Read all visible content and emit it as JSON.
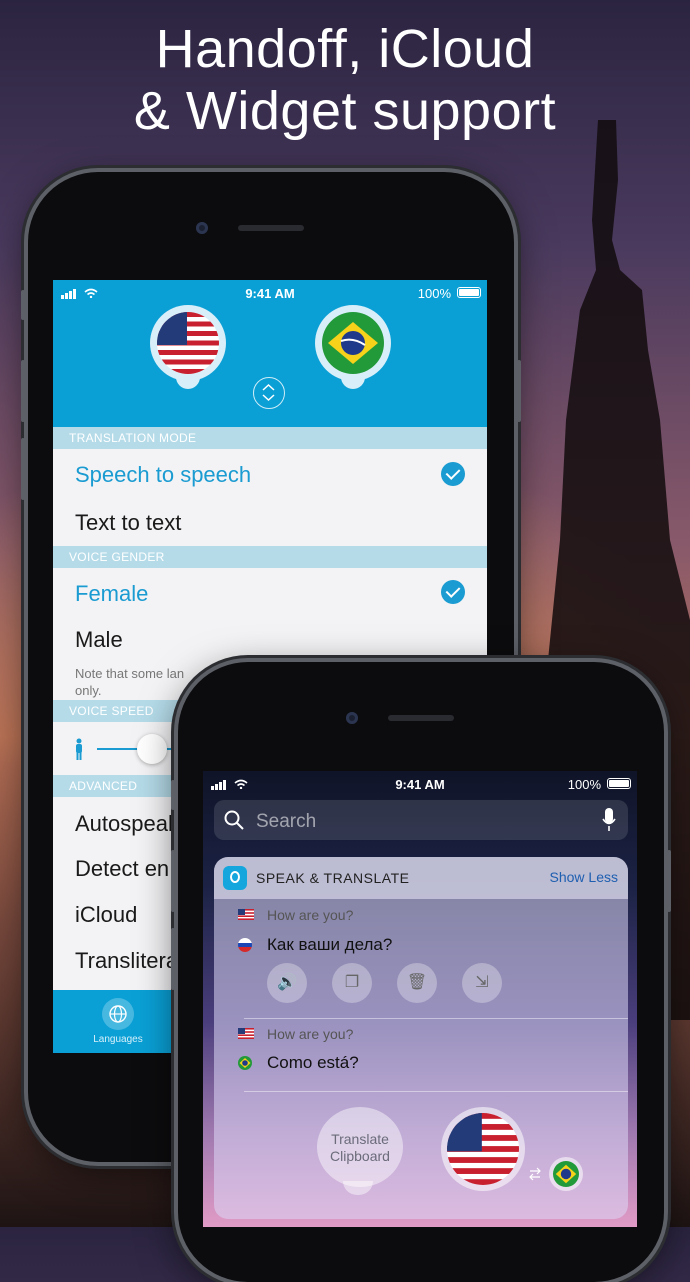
{
  "headline": {
    "line1": "Handoff, iCloud",
    "line2": "& Widget support"
  },
  "phone1": {
    "status": {
      "time": "9:41 AM",
      "battery": "100%"
    },
    "source_flag": "us-flag-icon",
    "target_flag": "brazil-flag-icon",
    "sections": {
      "translation_mode": "TRANSLATION MODE",
      "voice_gender": "VOICE GENDER",
      "voice_speed": "VOICE SPEED",
      "advanced": "ADVANCED"
    },
    "translation_mode": {
      "options": [
        "Speech to speech",
        "Text to text"
      ],
      "selected": "Speech to speech"
    },
    "voice_gender": {
      "options": [
        "Female",
        "Male"
      ],
      "selected": "Female"
    },
    "note": "Note that some lan",
    "note_line2": "only.",
    "advanced_items": [
      "Autospeak",
      "Detect en",
      "iCloud",
      "Translitera"
    ],
    "voice_speed_level": 0.45,
    "tab": {
      "label": "Languages"
    },
    "accent": "#0aa0d6"
  },
  "phone2": {
    "status": {
      "time": "9:41 AM",
      "battery": "100%"
    },
    "search": {
      "placeholder": "Search"
    },
    "widget": {
      "app_name": "SPEAK & TRANSLATE",
      "show_less": "Show Less",
      "translations": [
        {
          "source": "How are you?",
          "target": "Как ваши дела?",
          "source_flag": "us-flag-icon",
          "target_flag": "russia-flag-icon"
        },
        {
          "source": "How are you?",
          "target": "Como está?",
          "source_flag": "us-flag-icon",
          "target_flag": "brazil-flag-icon"
        }
      ],
      "actions": [
        "speaker-icon",
        "copy-icon",
        "delete-icon",
        "share-icon"
      ],
      "clipboard_button": {
        "line1": "Translate",
        "line2": "Clipboard"
      }
    }
  }
}
